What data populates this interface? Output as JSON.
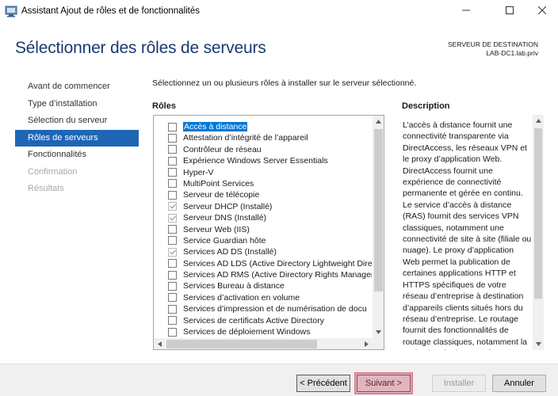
{
  "window": {
    "title": "Assistant Ajout de rôles et de fonctionnalités"
  },
  "header": {
    "page_title": "Sélectionner des rôles de serveurs",
    "destination_label": "SERVEUR DE DESTINATION",
    "destination_server": "LAB-DC1.lab.priv"
  },
  "nav": {
    "items": [
      {
        "label": "Avant de commencer",
        "state": "normal"
      },
      {
        "label": "Type d’installation",
        "state": "normal"
      },
      {
        "label": "Sélection du serveur",
        "state": "normal"
      },
      {
        "label": "Rôles de serveurs",
        "state": "active"
      },
      {
        "label": "Fonctionnalités",
        "state": "normal"
      },
      {
        "label": "Confirmation",
        "state": "disabled"
      },
      {
        "label": "Résultats",
        "state": "disabled"
      }
    ]
  },
  "main": {
    "instruction": "Sélectionnez un ou plusieurs rôles à installer sur le serveur sélectionné.",
    "roles_header": "Rôles",
    "description_header": "Description",
    "roles": [
      {
        "label": "Accès à distance",
        "checked": false,
        "focused": true
      },
      {
        "label": "Attestation d’intégrité de l’appareil",
        "checked": false
      },
      {
        "label": "Contrôleur de réseau",
        "checked": false
      },
      {
        "label": "Expérience Windows Server Essentials",
        "checked": false
      },
      {
        "label": "Hyper-V",
        "checked": false
      },
      {
        "label": "MultiPoint Services",
        "checked": false
      },
      {
        "label": "Serveur de télécopie",
        "checked": false
      },
      {
        "label": "Serveur DHCP (Installé)",
        "checked": true
      },
      {
        "label": "Serveur DNS (Installé)",
        "checked": true
      },
      {
        "label": "Serveur Web (IIS)",
        "checked": false
      },
      {
        "label": "Service Guardian hôte",
        "checked": false
      },
      {
        "label": "Services AD DS (Installé)",
        "checked": true
      },
      {
        "label": "Services AD LDS (Active Directory Lightweight Dire",
        "checked": false
      },
      {
        "label": "Services AD RMS (Active Directory Rights Managem",
        "checked": false
      },
      {
        "label": "Services Bureau à distance",
        "checked": false
      },
      {
        "label": "Services d’activation en volume",
        "checked": false
      },
      {
        "label": "Services d’impression et de numérisation de docu",
        "checked": false
      },
      {
        "label": "Services de certificats Active Directory",
        "checked": false
      },
      {
        "label": "Services de déploiement Windows",
        "checked": false
      }
    ],
    "description_text": "L’accès à distance fournit une connectivité transparente via DirectAccess, les réseaux VPN et le proxy d’application Web. DirectAccess fournit une expérience de connectivité permanente et gérée en continu. Le service d’accès à distance (RAS) fournit des services VPN classiques, notamment une connectivité de site à site (filiale ou nuage). Le proxy d’application Web permet la publication de certaines applications HTTP et HTTPS spécifiques de votre réseau d’entreprise à destination d’appareils clients situés hors du réseau d’entreprise. Le routage fournit des fonctionnalités de routage classiques, notamment la traduction d’adresses réseau"
  },
  "footer": {
    "prev_label": "< Précédent",
    "next_label": "Suivant >",
    "install_label": "Installer",
    "cancel_label": "Annuler"
  },
  "colors": {
    "accent": "#1e66b5",
    "title": "#1a3b6f",
    "highlight": "#e87a8c"
  }
}
